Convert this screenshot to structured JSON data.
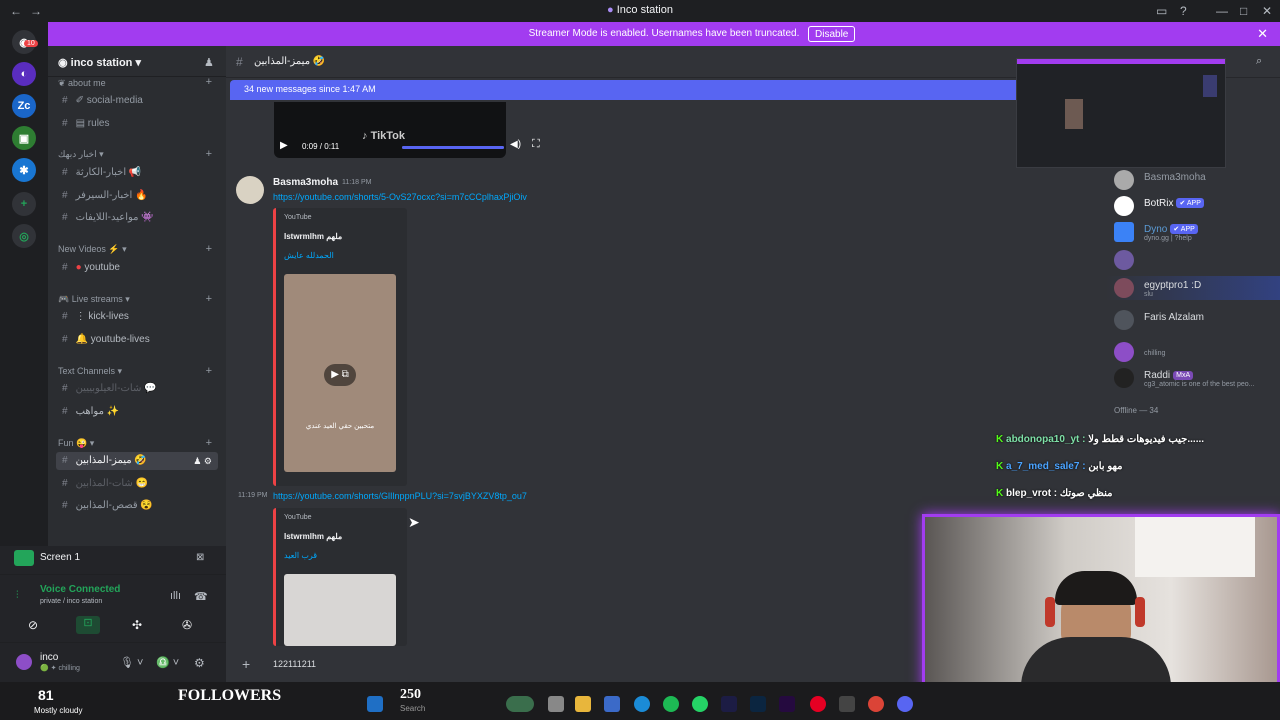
{
  "window": {
    "title": "Inco station"
  },
  "banner": {
    "message": "Streamer Mode is enabled. Usernames have been truncated.",
    "button": "Disable"
  },
  "server": {
    "name": "inco station",
    "rail_badge": "10"
  },
  "categories": [
    {
      "label": "about me"
    },
    {
      "label": "اخبار دبهك"
    },
    {
      "label": "New Videos"
    },
    {
      "label": "Live streams"
    },
    {
      "label": "Text Channels"
    },
    {
      "label": "Fun"
    }
  ],
  "channels": [
    {
      "label": "social-media"
    },
    {
      "label": "rules"
    },
    {
      "label": "اخبار-الكارثة"
    },
    {
      "label": "اخبار-السيرفر"
    },
    {
      "label": "مواعيد-اللايفات"
    },
    {
      "label": "youtube"
    },
    {
      "label": "kick-lives"
    },
    {
      "label": "youtube-lives"
    },
    {
      "label": "شات-العيلوبييين"
    },
    {
      "label": "مواهب"
    },
    {
      "label": "ميمز-المذابين"
    },
    {
      "label": "شات-المذابين"
    },
    {
      "label": "قصص-المذابين"
    }
  ],
  "chat": {
    "channel_title": "ميمز-المذابين",
    "new_messages": "34 new messages since 1:47 AM",
    "video_time": "0:09 / 0:11",
    "tiktok_label": "TikTok",
    "msg1": {
      "author": "Basma3moha",
      "time": "11:18 PM",
      "link": "https://youtube.com/shorts/5-OvS27ocxc?si=m7cCCplhaxPjiOiv",
      "embed_provider": "YouTube",
      "embed_author": "Istwrmlhm ملهم",
      "embed_title": "الحمدلله عايش",
      "thumb_caption": "متحبين حقي العيد عندي"
    },
    "msg2": {
      "time": "11:19 PM",
      "link": "https://youtube.com/shorts/GlIlnppnPLU?si=7svjBYXZV8tp_ou7",
      "embed_provider": "YouTube",
      "embed_author": "Istwrmlhm ملهم",
      "embed_title": "قرب العيد"
    },
    "input_text": "122111211"
  },
  "members": [
    {
      "name": "Basma3moha",
      "sub": ""
    },
    {
      "name": "BotRix",
      "tag": "✔ APP",
      "sub": ""
    },
    {
      "name": "Dyno",
      "tag": "✔ APP",
      "sub": "dyno.gg | ?help"
    },
    {
      "name": "",
      "sub": ""
    },
    {
      "name": "egyptpro1 :D",
      "sub": "slu"
    },
    {
      "name": "Faris Alzalam",
      "sub": ""
    },
    {
      "name": "",
      "sub": "chilling"
    },
    {
      "name": "Raddi",
      "tag": "MxA",
      "sub": "cg3_atomic is one of the best peo..."
    }
  ],
  "offline_label": "Offline — 34",
  "overlay_chat": [
    {
      "user": "abdonopa10_yt :",
      "text": "جيب فيديوهات قطط ولا......"
    },
    {
      "user": "a_7_med_sale7 :",
      "text": "مهو بابن"
    },
    {
      "user": "blep_vrot :",
      "text": "منظي صوتك"
    }
  ],
  "voice": {
    "stream_label": "Screen 1",
    "status": "Voice Connected",
    "location": "private / inco station",
    "user": "inco",
    "user_status": "chilling"
  },
  "taskbar": {
    "temperature": "81",
    "weather": "Mostly cloudy",
    "followers_label": "FOLLOWERS",
    "followers_count": "250",
    "search": "Search"
  }
}
